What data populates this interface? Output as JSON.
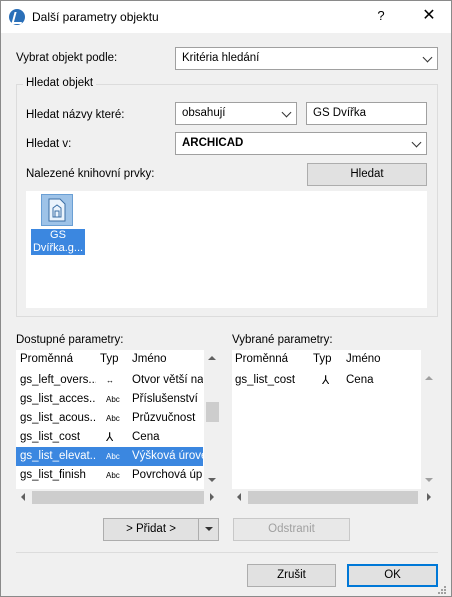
{
  "window": {
    "title": "Další parametry objektu",
    "help": "?",
    "close": "✕"
  },
  "select_by": {
    "label": "Vybrat objekt podle:",
    "value": "Kritéria hledání"
  },
  "search_group": {
    "title": "Hledat objekt",
    "names_label": "Hledat názvy které:",
    "names_mode": "obsahují",
    "names_value": "GS Dvířka",
    "search_in_label": "Hledat v:",
    "search_in_value": "ARCHICAD",
    "found_label": "Nalezené knihovní prvky:",
    "search_button": "Hledat",
    "found_items": [
      {
        "label": "GS Dvířka.g...",
        "icon": "library-part-icon"
      }
    ]
  },
  "available": {
    "title": "Dostupné parametry:",
    "headers": {
      "variable": "Proměnná",
      "type": "Typ",
      "name": "Jméno"
    },
    "rows": [
      {
        "variable": "gs_left_overs...",
        "type": "↔",
        "name": "Otvor větší na..."
      },
      {
        "variable": "gs_list_acces...",
        "type": "Abc",
        "name": "Příslušenství"
      },
      {
        "variable": "gs_list_acous...",
        "type": "Abc",
        "name": "Průzvučnost"
      },
      {
        "variable": "gs_list_cost",
        "type": "⅄",
        "name": "Cena"
      },
      {
        "variable": "gs_list_elevat...",
        "type": "Abc",
        "name": "Výšková úrove..."
      },
      {
        "variable": "gs_list_finish",
        "type": "Abc",
        "name": "Povrchová úp..."
      }
    ],
    "selected_row": 4
  },
  "chosen": {
    "title": "Vybrané parametry:",
    "headers": {
      "variable": "Proměnná",
      "type": "Typ",
      "name": "Jméno"
    },
    "rows": [
      {
        "variable": "gs_list_cost",
        "type": "⅄",
        "name": "Cena"
      }
    ]
  },
  "actions": {
    "add": "> Přidat >",
    "remove": "Odstranit",
    "cancel": "Zrušit",
    "ok": "OK"
  },
  "colors": {
    "accent": "#0078d7",
    "selection": "#3b87e0"
  }
}
